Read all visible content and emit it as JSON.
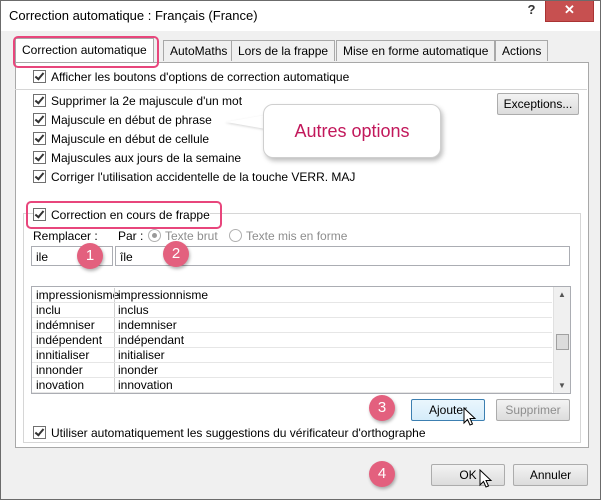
{
  "window": {
    "title": "Correction automatique : Français (France)",
    "help": "?",
    "close": "✕"
  },
  "tabs": [
    {
      "label": "Correction automatique"
    },
    {
      "label": "AutoMaths"
    },
    {
      "label": "Lors de la frappe"
    },
    {
      "label": "Mise en forme automatique"
    },
    {
      "label": "Actions"
    }
  ],
  "options": {
    "show_buttons": "Afficher les boutons d'options de correction automatique",
    "items": [
      "Supprimer la 2e majuscule d'un mot",
      "Majuscule en début de phrase",
      "Majuscule en début de cellule",
      "Majuscules aux jours de la semaine",
      "Corriger l'utilisation accidentelle de la touche VERR. MAJ"
    ],
    "exceptions_button": "Exceptions..."
  },
  "callout": {
    "text": "Autres options"
  },
  "replace": {
    "checkbox_label": "Correction en cours de frappe",
    "replace_label": "Remplacer :",
    "by_label": "Par :",
    "radio_plain": "Texte brut",
    "radio_formatted": "Texte mis en forme",
    "replace_value": "ile",
    "by_value": "île",
    "entries": [
      [
        "impressionisme",
        "impressionnisme"
      ],
      [
        "inclu",
        "inclus"
      ],
      [
        "indémniser",
        "indemniser"
      ],
      [
        "indépendent",
        "indépendant"
      ],
      [
        "innitialiser",
        "initialiser"
      ],
      [
        "innonder",
        "inonder"
      ],
      [
        "inovation",
        "innovation"
      ]
    ],
    "add_button": "Ajouter",
    "delete_button": "Supprimer",
    "suggestions_label": "Utiliser automatiquement les suggestions du vérificateur d'orthographe"
  },
  "footer": {
    "ok": "OK",
    "cancel": "Annuler"
  },
  "badges": [
    "1",
    "2",
    "3",
    "4"
  ],
  "colors": {
    "accent": "#e8467c",
    "badge": "#e3607e",
    "callout_text": "#c2185b"
  }
}
